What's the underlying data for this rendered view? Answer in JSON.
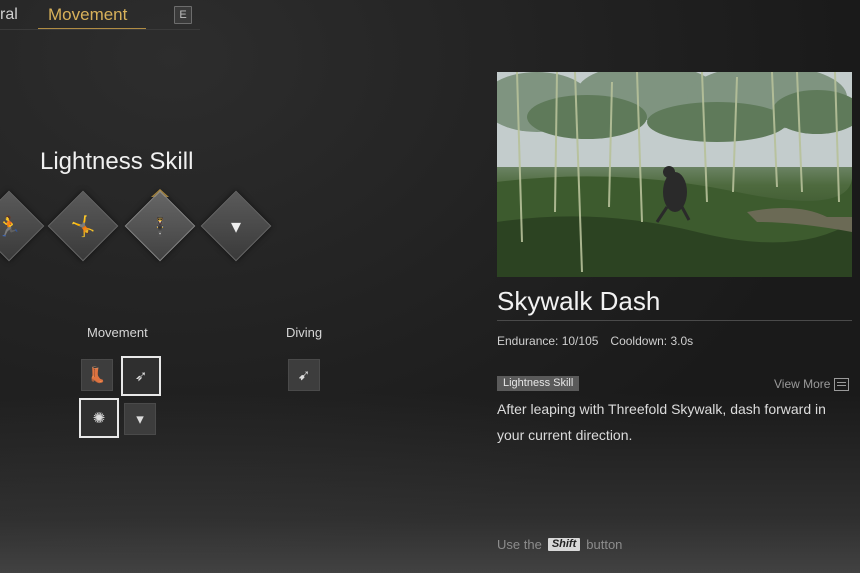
{
  "tabs": {
    "general_partial": "ral",
    "active": "Movement",
    "key_hint": "E"
  },
  "section": {
    "title": "Lightness Skill"
  },
  "diamonds": [
    {
      "icon": "leap-figure-icon",
      "glyph": "🏃"
    },
    {
      "icon": "spin-figure-icon",
      "glyph": "🤸"
    },
    {
      "icon": "skywalk-figure-icon",
      "glyph": "🕴"
    },
    {
      "icon": "empty-slot-icon",
      "glyph": "▾"
    }
  ],
  "groups": {
    "movement_label": "Movement",
    "diving_label": "Diving"
  },
  "slots": {
    "boot": "👢",
    "dash": "➶",
    "swirl": "✺",
    "empty": "▾",
    "dive": "➹"
  },
  "detail": {
    "name": "Skywalk Dash",
    "endurance": "Endurance: 10/105",
    "cooldown": "Cooldown: 3.0s",
    "tag": "Lightness Skill",
    "view_more": "View More",
    "description": "After leaping with Threefold Skywalk, dash forward in your current direction.",
    "hint_prefix": "Use the",
    "hint_key": "Shift",
    "hint_suffix": "button"
  },
  "colors": {
    "accent": "#d8b15a",
    "tag_bg": "#5a5a5a"
  }
}
